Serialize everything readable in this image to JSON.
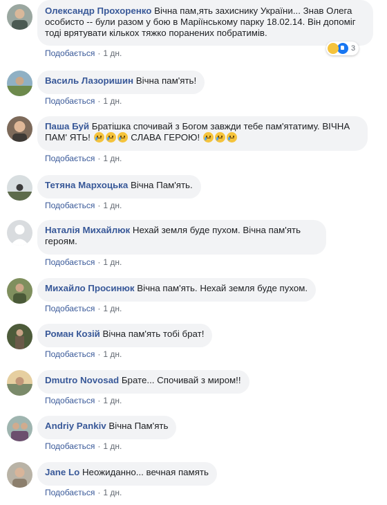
{
  "like_label": "Подобається",
  "separator": "·",
  "time_label": "1 дн.",
  "reaction_count": "3",
  "comments": [
    {
      "author": "Олександр Прохоренко",
      "text": "Вічна пам,ять захиснику України... Знав Олега особисто -- були разом у бою в Маріїнському парку 18.02.14. Він допоміг тоді врятувати кількох тяжко поранених побратимів."
    },
    {
      "author": "Василь Лазоришин",
      "text": "Вічна пам'ять!"
    },
    {
      "author": "Паша Буй",
      "text_a": "Братішка спочивай з Богом завжди тебе пам'ятатиму. ВІЧНА ПАМ' ЯТЬ!",
      "text_b": "СЛАВА ГЕРОЮ!"
    },
    {
      "author": "Тетяна Мархоцька",
      "text": "Вічна Пам'ять."
    },
    {
      "author": "Наталія Михайлюк",
      "text": "Нехай земля буде пухом. Вічна пам'ять героям."
    },
    {
      "author": "Михайло Просинюк",
      "text": "Вічна пам'ять. Нехай земля буде пухом."
    },
    {
      "author": "Роман Козій",
      "text": "Вічна пам'ять тобі брат!"
    },
    {
      "author": "Dmutro Novosad",
      "text": "Брате... Спочивай з миром!!"
    },
    {
      "author": "Andriy Pankiv",
      "text": "Вічна Пам'ять"
    },
    {
      "author": "Jane Lo",
      "text": "Неожиданно... вечная память"
    }
  ],
  "colors": {
    "author": "#385898",
    "bubble": "#f2f3f5",
    "meta": "#616770"
  }
}
